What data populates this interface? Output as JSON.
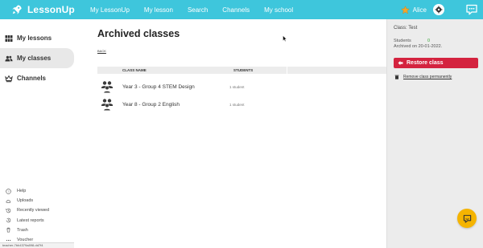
{
  "colors": {
    "topbar": "#3ec6dc",
    "restore": "#d4233f",
    "help": "#f5b400",
    "students_count": "#3aa63a"
  },
  "app": {
    "name": "LessonUp",
    "logo_icon": "rocket-icon"
  },
  "nav": [
    "My LessonUp",
    "My lesson",
    "Search",
    "Channels",
    "My school"
  ],
  "user": {
    "name": "Alice",
    "badge_icon": "star-icon"
  },
  "sidebar": {
    "items": [
      {
        "label": "My lessons",
        "icon": "grid-icon"
      },
      {
        "label": "My classes",
        "icon": "people-icon"
      },
      {
        "label": "Channels",
        "icon": "crown-icon"
      }
    ],
    "bottom": [
      {
        "label": "Help",
        "icon": "help-icon"
      },
      {
        "label": "Uploads",
        "icon": "cloud-icon"
      },
      {
        "label": "Recently viewed",
        "icon": "history-icon"
      },
      {
        "label": "Latest reports",
        "icon": "reports-icon"
      },
      {
        "label": "Trash",
        "icon": "trash-icon"
      },
      {
        "label": "Voucher",
        "icon": "voucher-icon"
      }
    ],
    "status_url": "teacher-7bb4379a898-dd7f4"
  },
  "main": {
    "title": "Archived classes",
    "back": "BACK",
    "table": {
      "headers": {
        "name": "CLASS NAME",
        "students": "STUDENTS"
      },
      "rows": [
        {
          "name": "Year 3 - Group 4 STEM Design",
          "students": "1 student"
        },
        {
          "name": "Year 8 - Group 2 English",
          "students": "1 student"
        }
      ]
    }
  },
  "panel": {
    "title": "Class: Test",
    "students_label": "Students",
    "students_count": "0",
    "archived": "Archived on 20-01-2022.",
    "restore": "Restore class",
    "remove": "Remove class permanently"
  }
}
